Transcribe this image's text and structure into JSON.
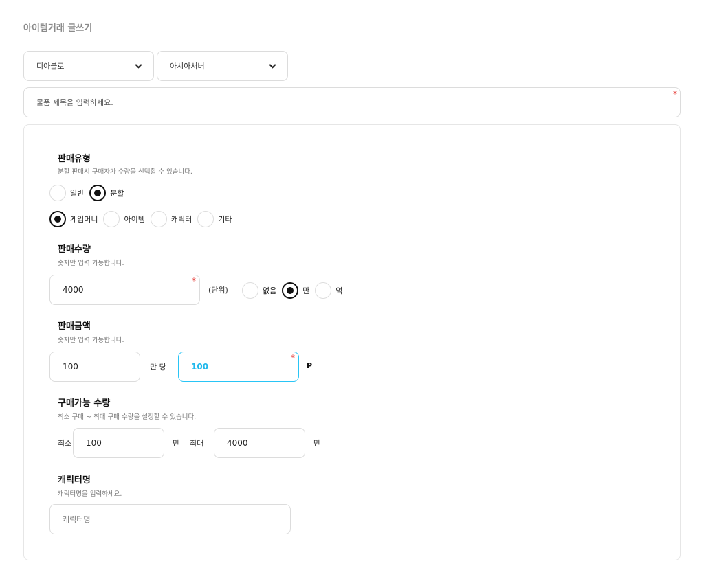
{
  "page": {
    "title": "아이템거래 글쓰기"
  },
  "selects": {
    "game": {
      "value": "디아블로"
    },
    "server": {
      "value": "아시아서버"
    }
  },
  "title_input": {
    "placeholder": "물품 제목을 입력하세요.",
    "required_mark": "*"
  },
  "sale_type": {
    "title": "판매유형",
    "desc": "분할 판매시 구매자가 수량을 선택할 수 있습니다.",
    "mode_options": [
      {
        "label": "일반",
        "checked": false
      },
      {
        "label": "분할",
        "checked": true
      }
    ],
    "category_options": [
      {
        "label": "게임머니",
        "checked": true
      },
      {
        "label": "아이템",
        "checked": false
      },
      {
        "label": "캐릭터",
        "checked": false
      },
      {
        "label": "기타",
        "checked": false
      }
    ]
  },
  "quantity": {
    "title": "판매수량",
    "desc": "숫자만 입력 가능합니다.",
    "value": "4000",
    "required_mark": "*",
    "unit_label": "(단위)",
    "unit_options": [
      {
        "label": "없음",
        "checked": false
      },
      {
        "label": "만",
        "checked": true
      },
      {
        "label": "억",
        "checked": false
      }
    ]
  },
  "price": {
    "title": "판매금액",
    "desc": "숫자만 입력 가능합니다.",
    "per_value": "100",
    "per_label": "만 당",
    "amount_value": "100",
    "required_mark": "*",
    "currency": "P"
  },
  "purchase_range": {
    "title": "구매가능 수량",
    "desc": "최소 구매 ~ 최대 구매 수량을 설정할 수 있습니다.",
    "min_label": "최소",
    "min_value": "100",
    "min_unit": "만",
    "max_label": "최대",
    "max_value": "4000",
    "max_unit": "만"
  },
  "character": {
    "title": "캐릭터명",
    "desc": "캐릭터명을 입력하세요.",
    "placeholder": "캐릭터명"
  },
  "colors": {
    "accent": "#29c5f6",
    "required": "#e53935",
    "border": "#dcdcdc"
  }
}
